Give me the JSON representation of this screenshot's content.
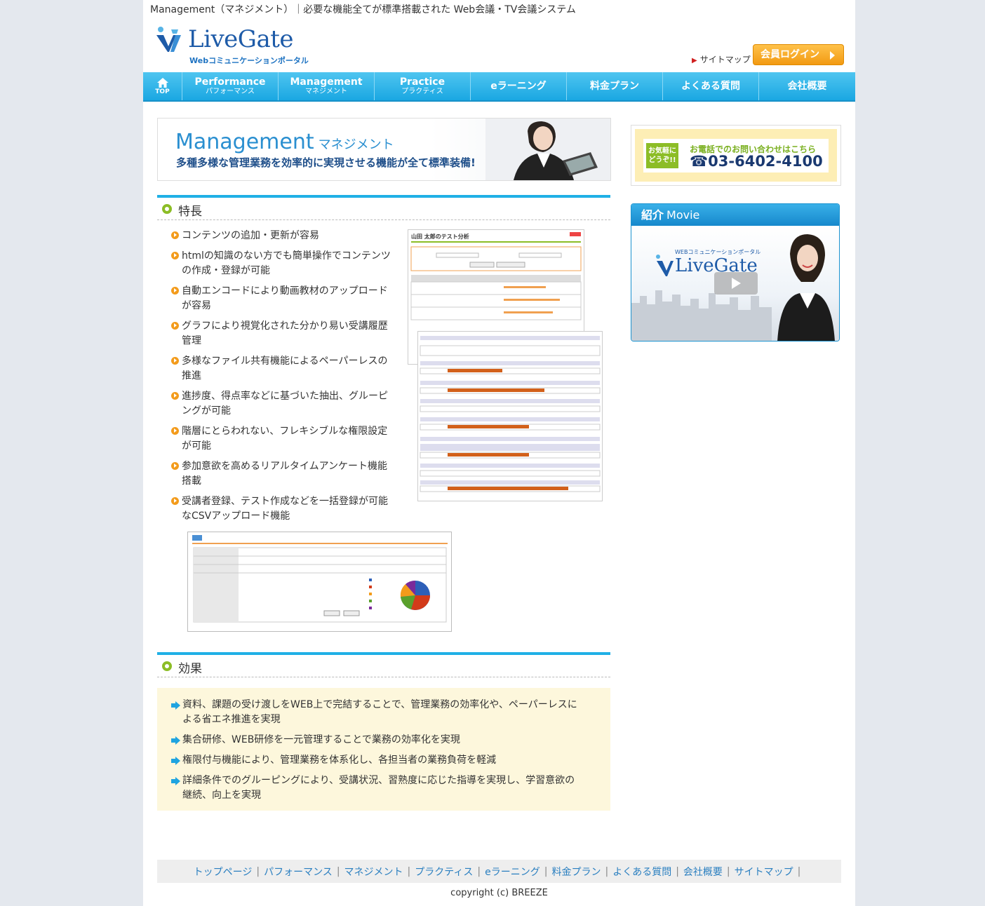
{
  "header": {
    "tagline": "Management（マネジメント）｜必要な機能全てが標準搭載された Web会議・TV会議システム",
    "logo_text": "LiveGate",
    "logo_sub": "Webコミュニケーションポータル",
    "sitemap_label": "サイトマップ",
    "login_label": "会員ログイン"
  },
  "nav": {
    "top_label": "TOP",
    "items": [
      {
        "main": "Performance",
        "sub": "パフォーマンス"
      },
      {
        "main": "Management",
        "sub": "マネジメント"
      },
      {
        "main": "Practice",
        "sub": "プラクティス"
      },
      {
        "main": "eラーニング",
        "sub": ""
      },
      {
        "main": "料金プラン",
        "sub": ""
      },
      {
        "main": "よくある質問",
        "sub": ""
      },
      {
        "main": "会社概要",
        "sub": ""
      }
    ]
  },
  "banner": {
    "title": "Management",
    "title_jp": "マネジメント",
    "subtitle": "多種多様な管理業務を効率的に実現させる機能が全て標準装備!"
  },
  "features": {
    "heading": "特長",
    "items": [
      "コンテンツの追加・更新が容易",
      "htmlの知識のない方でも簡単操作でコンテンツの作成・登録が可能",
      "自動エンコードにより動画教材のアップロードが容易",
      "グラフにより視覚化された分かり易い受講履歴管理",
      "多様なファイル共有機能によるペーパーレスの推進",
      "進捗度、得点率などに基づいた抽出、グルーピングが可能",
      "階層にとらわれない、フレキシブルな権限設定が可能",
      "参加意欲を高めるリアルタイムアンケート機能搭載",
      "受講者登録、テスト作成などを一括登録が可能なCSVアップロード機能"
    ]
  },
  "screenshots": {
    "shot1_title": "山田 太郎のテスト分析"
  },
  "effects": {
    "heading": "効果",
    "items": [
      "資料、課題の受け渡しをWEB上で完結することで、管理業務の効率化や、ペーパーレスによる省エネ推進を実現",
      "集合研修、WEB研修を一元管理することで業務の効率化を実現",
      "権限付与機能により、管理業務を体系化し、各担当者の業務負荷を軽減",
      "詳細条件でのグルーピングにより、受講状況、習熟度に応じた指導を実現し、学習意欲の継続、向上を実現"
    ]
  },
  "sidebar": {
    "phone_badge": "お気軽にどうぞ!!",
    "phone_label": "お電話でのお問い合わせはこちら",
    "phone_number": "☎03-6402-4100",
    "movie_title": "紹介",
    "movie_title_en": "Movie",
    "movie_logo_sub": "WEBコミュニケーションポータル",
    "movie_logo": "LiveGate"
  },
  "footer": {
    "links": [
      "トップページ",
      "パフォーマンス",
      "マネジメント",
      "プラクティス",
      "eラーニング",
      "料金プラン",
      "よくある質問",
      "会社概要",
      "サイトマップ"
    ],
    "copyright": "copyright (c) BREEZE"
  },
  "colors": {
    "nav_blue": "#1fb0e6",
    "accent_orange": "#f39b1b",
    "accent_green": "#8cbd26",
    "effects_bg": "#fdf7dc"
  }
}
